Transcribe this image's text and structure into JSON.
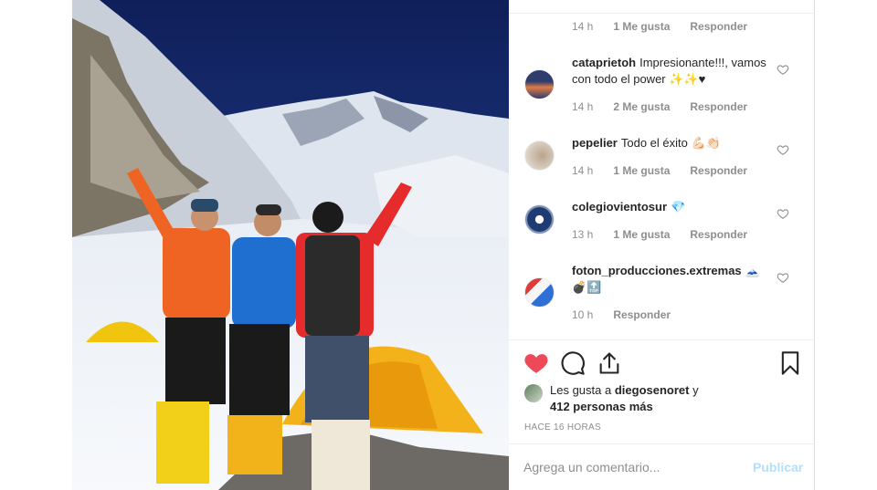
{
  "post_image": {
    "alt": ""
  },
  "comments_top": {
    "time": "14 h",
    "likes": "1 Me gusta",
    "reply": "Responder"
  },
  "comments": [
    {
      "user": "cataprietoh",
      "text": "Impresionante!!!, vamos con todo el power ✨✨♥",
      "time": "14 h",
      "likes": "2 Me gusta",
      "reply": "Responder",
      "avatar_color": "#2f3c6e"
    },
    {
      "user": "pepelier",
      "text": "Todo el éxito 💪🏻👏🏻",
      "time": "14 h",
      "likes": "1 Me gusta",
      "reply": "Responder",
      "avatar_color": "#d7cfc3"
    },
    {
      "user": "colegiovientosur",
      "text": "💎",
      "time": "13 h",
      "likes": "1 Me gusta",
      "reply": "Responder",
      "avatar_color": "#1e3c73"
    },
    {
      "user": "foton_producciones.extremas",
      "text": "🗻 💣🔝",
      "time": "10 h",
      "likes": "",
      "reply": "Responder",
      "avatar_color": "#9ab6d9"
    }
  ],
  "actions": {
    "like_icon": "heart-filled-icon",
    "comment_icon": "comment-icon",
    "share_icon": "share-icon",
    "save_icon": "bookmark-icon",
    "like_color": "#ed4956"
  },
  "likes": {
    "prefix": "Les gusta a",
    "user": "diegosenoret",
    "connector": "y",
    "others": "412 personas más"
  },
  "timestamp": "HACE 16 HORAS",
  "add_comment": {
    "placeholder": "Agrega un comentario...",
    "publish_label": "Publicar"
  }
}
